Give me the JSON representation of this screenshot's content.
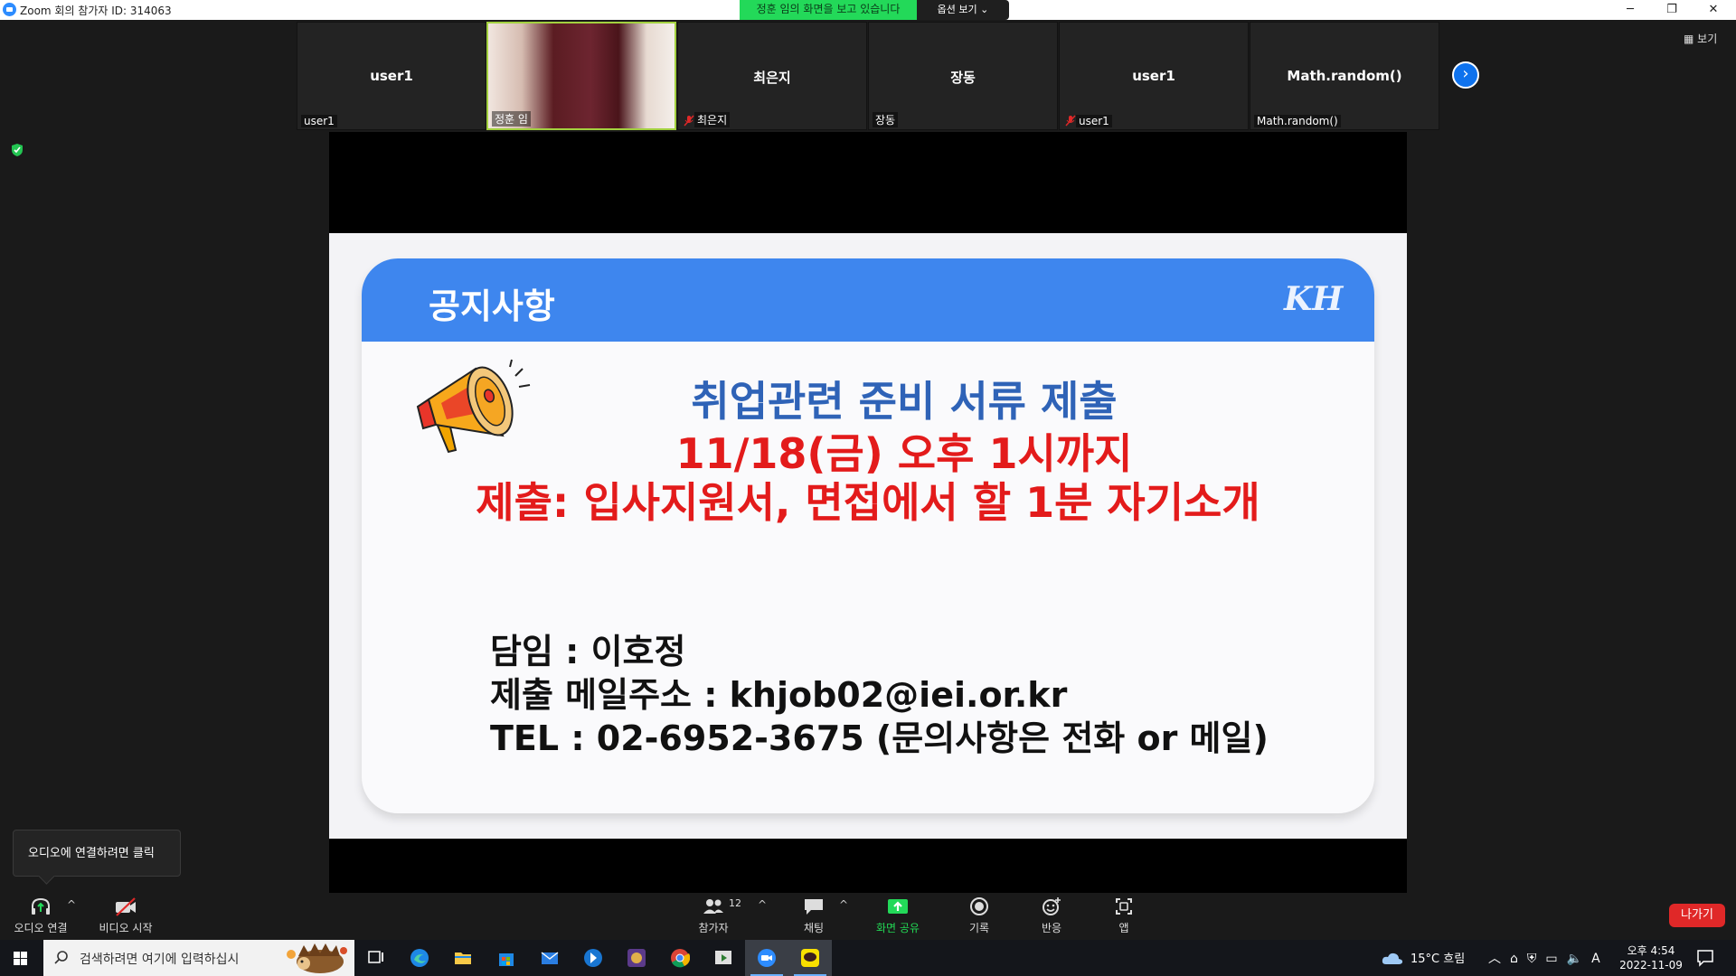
{
  "window": {
    "title": "Zoom 회의 참가자 ID: 314063",
    "controls": [
      "─",
      "❐",
      "✕"
    ]
  },
  "share_banner": {
    "text": "정훈 임의 화면을 보고 있습니다",
    "view_options": "옵션 보기 ⌄"
  },
  "participants": [
    {
      "name": "user1",
      "label": "user1",
      "muted": false
    },
    {
      "name": "",
      "label": "정훈 임",
      "muted": false,
      "video": true
    },
    {
      "name": "최은지",
      "label": "최은지",
      "muted": true
    },
    {
      "name": "장동",
      "label": "장동",
      "muted": false
    },
    {
      "name": "user1",
      "label": "user1",
      "muted": true
    },
    {
      "name": "Math.random()",
      "label": "Math.random()",
      "muted": false
    }
  ],
  "view_button": "보기",
  "slide": {
    "header_title": "공지사항",
    "logo_text": "KH",
    "line1": "취업관련 준비 서류 제출",
    "line2": "11/18(금) 오후 1시까지",
    "line3": "제출: 입사지원서, 면접에서 할 1분 자기소개",
    "info1": "담임 : 이호정",
    "info2": "제출 메일주소 : khjob02@iei.or.kr",
    "info3": "TEL : 02-6952-3675 (문의사항은 전화 or 메일)"
  },
  "tooltip": "오디오에 연결하려면 클릭",
  "toolbar": {
    "audio": "오디오 연결",
    "video": "비디오 시작",
    "participants": "참가자",
    "participant_count": "12",
    "chat": "채팅",
    "share": "화면 공유",
    "record": "기록",
    "reactions": "반응",
    "apps": "앱",
    "leave": "나가기",
    "caret": "^"
  },
  "taskbar": {
    "search_placeholder": "검색하려면 여기에 입력하십시",
    "apps": [
      "task-view",
      "edge",
      "file-explorer",
      "store",
      "mail",
      "pin-app",
      "game-app",
      "chrome",
      "media-app",
      "zoom",
      "kakaotalk"
    ],
    "weather": "15°C 흐림",
    "time": "오후 4:54",
    "date": "2022-11-09",
    "ime": "A"
  },
  "colors": {
    "zoom_blue": "#2d8cff",
    "share_green": "#23d959",
    "slide_header": "#3e86ee",
    "slide_blue_text": "#2f63b7",
    "slide_red_text": "#e31b1b",
    "leave_red": "#e02828"
  }
}
